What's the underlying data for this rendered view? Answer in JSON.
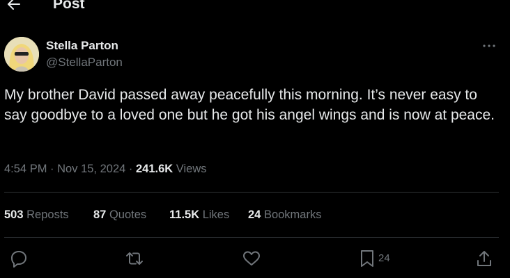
{
  "header": {
    "title": "Post",
    "back_icon": "arrow-left-icon"
  },
  "author": {
    "name": "Stella Parton",
    "handle": "@StellaParton"
  },
  "post": {
    "text": "My brother David passed away peacefully this morning. It’s never easy to say goodbye to a loved one but he got his angel wings and is now at peace.",
    "time": "4:54 PM",
    "date": "Nov 15, 2024",
    "views_count": "241.6K",
    "views_label": "Views"
  },
  "stats": {
    "reposts": {
      "count": "503",
      "label": "Reposts"
    },
    "quotes": {
      "count": "87",
      "label": "Quotes"
    },
    "likes": {
      "count": "11.5K",
      "label": "Likes"
    },
    "bookmarks": {
      "count": "24",
      "label": "Bookmarks"
    }
  },
  "actions": {
    "reply_icon": "reply-icon",
    "repost_icon": "repost-icon",
    "like_icon": "heart-icon",
    "bookmark_icon": "bookmark-icon",
    "bookmark_count": "24",
    "share_icon": "share-icon"
  },
  "colors": {
    "background": "#000000",
    "text": "#e7e9ea",
    "secondary": "#71767b",
    "divider": "#2f3336"
  }
}
